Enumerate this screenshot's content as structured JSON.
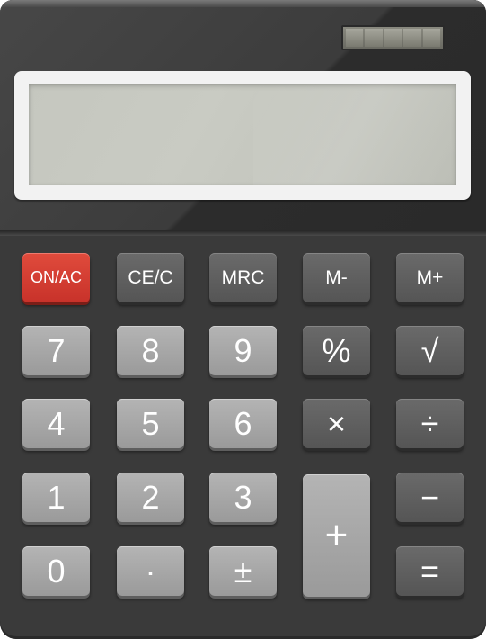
{
  "keys": {
    "on_ac": "ON/AC",
    "ce_c": "CE/C",
    "mrc": "MRC",
    "m_minus": "M-",
    "m_plus": "M+",
    "seven": "7",
    "eight": "8",
    "nine": "9",
    "percent": "%",
    "sqrt": "√",
    "four": "4",
    "five": "5",
    "six": "6",
    "multiply": "×",
    "divide": "÷",
    "one": "1",
    "two": "2",
    "three": "3",
    "plus": "+",
    "minus": "−",
    "zero": "0",
    "decimal": "·",
    "plus_minus": "±",
    "equals": "="
  },
  "colors": {
    "body": "#3a3a3a",
    "key_light": "#a8a8a8",
    "key_dark": "#5e5e5e",
    "key_red": "#d43c30",
    "display": "#c5c7bf"
  }
}
